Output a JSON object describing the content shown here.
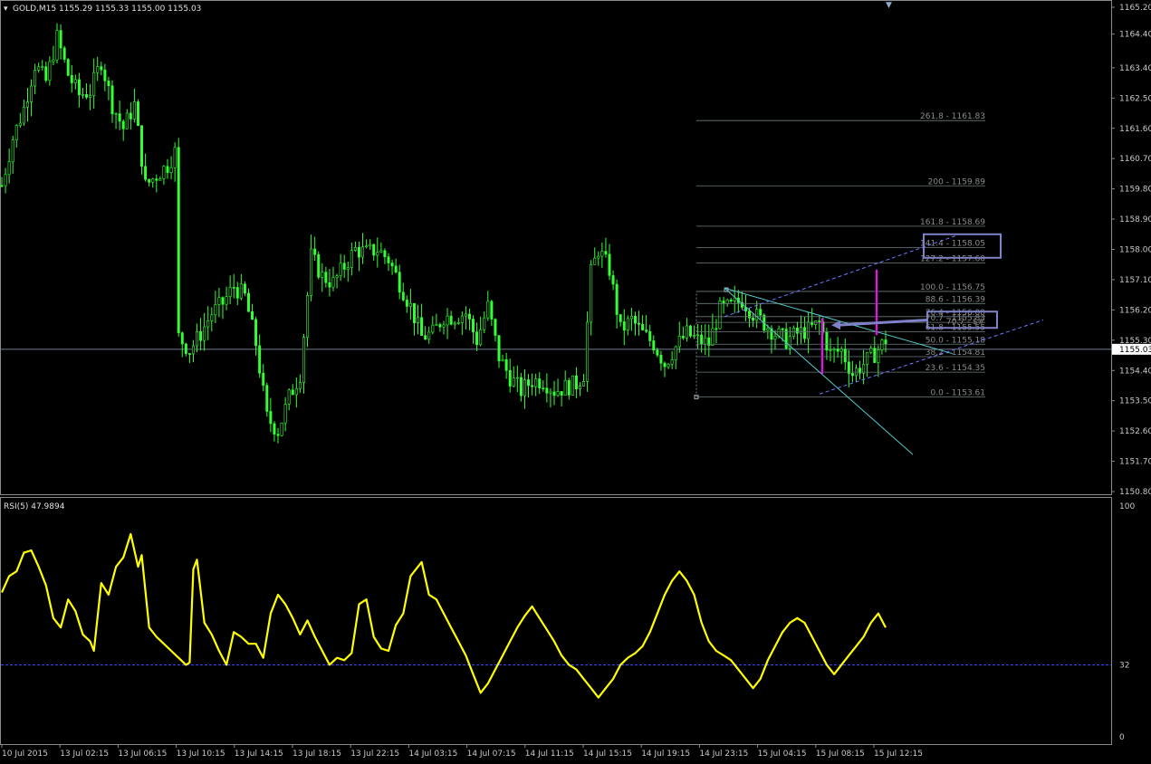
{
  "window": {
    "symbol_line": "GOLD,M15  1155.29 1155.33 1155.00 1155.03",
    "rsi_header": "RSI(5) 47.9894"
  },
  "colors": {
    "background": "#000000",
    "candle": "#34ff34",
    "rsi": "#ffff00",
    "trendline": "#52c8c8",
    "channel": "#6a7aff",
    "fib": "#6e7b7b",
    "box": "#7f82c8",
    "magenta": "#ff00ff",
    "price_line": "#8fa8c8",
    "level32": "#2a4cff"
  },
  "chart_data": [
    {
      "type": "candlestick",
      "title": "GOLD,M15",
      "ylim": [
        1150.8,
        1165.2
      ],
      "price_ticks": [
        "1165.20",
        "1164.40",
        "1163.40",
        "1162.50",
        "1161.60",
        "1160.70",
        "1159.80",
        "1158.90",
        "1158.00",
        "1157.10",
        "1156.20",
        "1155.30",
        "1154.40",
        "1153.50",
        "1152.60",
        "1151.70",
        "1150.80"
      ],
      "current_price": "1155.03",
      "x_labels": [
        "10 Jul 2015",
        "13 Jul 02:15",
        "13 Jul 06:15",
        "13 Jul 10:15",
        "13 Jul 14:15",
        "13 Jul 18:15",
        "13 Jul 22:15",
        "14 Jul 03:15",
        "14 Jul 07:15",
        "14 Jul 11:15",
        "14 Jul 15:15",
        "14 Jul 19:15",
        "14 Jul 23:15",
        "15 Jul 04:15",
        "15 Jul 08:15",
        "15 Jul 12:15"
      ],
      "close_path": [
        [
          0,
          1159.9
        ],
        [
          3,
          1161.3
        ],
        [
          6,
          1162.2
        ],
        [
          9,
          1163.5
        ],
        [
          12,
          1163.0
        ],
        [
          15,
          1164.3
        ],
        [
          18,
          1163.2
        ],
        [
          21,
          1162.6
        ],
        [
          24,
          1162.7
        ],
        [
          27,
          1163.6
        ],
        [
          30,
          1162.3
        ],
        [
          33,
          1161.6
        ],
        [
          36,
          1162.3
        ],
        [
          39,
          1159.9
        ],
        [
          42,
          1160.2
        ],
        [
          45,
          1160.5
        ],
        [
          47,
          1160.9
        ],
        [
          48,
          1155.4
        ],
        [
          51,
          1155.0
        ],
        [
          54,
          1155.5
        ],
        [
          57,
          1156.1
        ],
        [
          60,
          1156.4
        ],
        [
          63,
          1156.9
        ],
        [
          66,
          1156.6
        ],
        [
          69,
          1155.2
        ],
        [
          72,
          1153.0
        ],
        [
          75,
          1152.6
        ],
        [
          78,
          1153.6
        ],
        [
          81,
          1154.3
        ],
        [
          84,
          1157.8
        ],
        [
          87,
          1157.2
        ],
        [
          90,
          1157.0
        ],
        [
          93,
          1157.5
        ],
        [
          96,
          1158.0
        ],
        [
          99,
          1157.9
        ],
        [
          102,
          1158.0
        ],
        [
          105,
          1157.7
        ],
        [
          108,
          1157.0
        ],
        [
          111,
          1156.3
        ],
        [
          114,
          1155.4
        ],
        [
          117,
          1155.5
        ],
        [
          120,
          1156.0
        ],
        [
          123,
          1156.0
        ],
        [
          126,
          1156.1
        ],
        [
          129,
          1155.3
        ],
        [
          132,
          1156.3
        ],
        [
          135,
          1154.8
        ],
        [
          138,
          1154.2
        ],
        [
          141,
          1153.8
        ],
        [
          144,
          1154.1
        ],
        [
          147,
          1154.1
        ],
        [
          150,
          1153.8
        ],
        [
          153,
          1153.9
        ],
        [
          156,
          1154.0
        ],
        [
          158,
          1154.3
        ],
        [
          160,
          1157.3
        ],
        [
          162,
          1158.0
        ],
        [
          165,
          1157.4
        ],
        [
          168,
          1155.6
        ],
        [
          171,
          1155.9
        ],
        [
          174,
          1155.5
        ],
        [
          177,
          1155.2
        ],
        [
          180,
          1154.6
        ],
        [
          183,
          1155.1
        ],
        [
          186,
          1155.5
        ],
        [
          189,
          1155.3
        ],
        [
          192,
          1155.2
        ],
        [
          195,
          1156.2
        ],
        [
          198,
          1156.3
        ],
        [
          201,
          1156.5
        ],
        [
          204,
          1156.1
        ],
        [
          207,
          1155.8
        ],
        [
          210,
          1155.5
        ],
        [
          213,
          1155.3
        ],
        [
          216,
          1155.5
        ],
        [
          219,
          1155.6
        ],
        [
          222,
          1155.8
        ],
        [
          225,
          1154.9
        ],
        [
          228,
          1155.0
        ],
        [
          231,
          1154.3
        ],
        [
          234,
          1154.6
        ],
        [
          237,
          1154.9
        ],
        [
          240,
          1155.3
        ]
      ],
      "fib_levels": [
        {
          "ratio": "0.0",
          "price": 1153.61,
          "label": "0.0 - 1153.61"
        },
        {
          "ratio": "23.6",
          "price": 1154.35,
          "label": "23.6 - 1154.35"
        },
        {
          "ratio": "38.2",
          "price": 1154.81,
          "label": "38.2 - 1154.81"
        },
        {
          "ratio": "50.0",
          "price": 1155.18,
          "label": "50.0 - 1155.18"
        },
        {
          "ratio": "61.8",
          "price": 1155.55,
          "label": "61.8 - 1155.55"
        },
        {
          "ratio": "70.7",
          "price": 1155.83,
          "label": "70.7 - 1155.83"
        },
        {
          "ratio": "76.4",
          "price": 1156.0,
          "label": "76.4 - 1156.00"
        },
        {
          "ratio": "88.6",
          "price": 1156.39,
          "label": "88.6 - 1156.39"
        },
        {
          "ratio": "100.0",
          "price": 1156.75,
          "label": "100.0 - 1156.75"
        },
        {
          "ratio": "127.2",
          "price": 1157.6,
          "label": "127.2 - 1157.60"
        },
        {
          "ratio": "141.4",
          "price": 1158.05,
          "label": "141.4 - 1158.05"
        },
        {
          "ratio": "161.8",
          "price": 1158.69,
          "label": "161.8 - 1158.69"
        },
        {
          "ratio": "200",
          "price": 1159.89,
          "label": "200 - 1159.89"
        },
        {
          "ratio": "261.8",
          "price": 1161.83,
          "label": "261.8 - 1161.83"
        }
      ],
      "box_label": "70.7 - $#"
    },
    {
      "type": "line",
      "title": "RSI(5) 47.9894",
      "ylim": [
        0,
        100
      ],
      "ticks": [
        "100",
        "32",
        "0"
      ],
      "level": 32,
      "values": [
        [
          0,
          63
        ],
        [
          2,
          70
        ],
        [
          4,
          72
        ],
        [
          6,
          80
        ],
        [
          8,
          81
        ],
        [
          10,
          74
        ],
        [
          12,
          66
        ],
        [
          14,
          52
        ],
        [
          16,
          48
        ],
        [
          18,
          60
        ],
        [
          20,
          55
        ],
        [
          22,
          45
        ],
        [
          24,
          42
        ],
        [
          25,
          38
        ],
        [
          27,
          67
        ],
        [
          29,
          62
        ],
        [
          31,
          74
        ],
        [
          33,
          78
        ],
        [
          35,
          88
        ],
        [
          37,
          74
        ],
        [
          38,
          79
        ],
        [
          40,
          48
        ],
        [
          42,
          44
        ],
        [
          44,
          41
        ],
        [
          46,
          38
        ],
        [
          48,
          35
        ],
        [
          50,
          32
        ],
        [
          51,
          33
        ],
        [
          52,
          73
        ],
        [
          53,
          77
        ],
        [
          55,
          50
        ],
        [
          57,
          45
        ],
        [
          59,
          38
        ],
        [
          61,
          32
        ],
        [
          63,
          46
        ],
        [
          65,
          44
        ],
        [
          67,
          41
        ],
        [
          69,
          41
        ],
        [
          71,
          35
        ],
        [
          73,
          54
        ],
        [
          75,
          62
        ],
        [
          77,
          58
        ],
        [
          79,
          52
        ],
        [
          81,
          45
        ],
        [
          83,
          51
        ],
        [
          85,
          44
        ],
        [
          87,
          38
        ],
        [
          89,
          32
        ],
        [
          91,
          35
        ],
        [
          93,
          34
        ],
        [
          95,
          37
        ],
        [
          97,
          58
        ],
        [
          99,
          60
        ],
        [
          101,
          44
        ],
        [
          103,
          39
        ],
        [
          105,
          38
        ],
        [
          107,
          49
        ],
        [
          109,
          54
        ],
        [
          111,
          70
        ],
        [
          113,
          74
        ],
        [
          114,
          76
        ],
        [
          116,
          62
        ],
        [
          118,
          60
        ],
        [
          120,
          54
        ],
        [
          122,
          48
        ],
        [
          124,
          42
        ],
        [
          126,
          36
        ],
        [
          128,
          28
        ],
        [
          130,
          20
        ],
        [
          132,
          24
        ],
        [
          134,
          30
        ],
        [
          136,
          36
        ],
        [
          138,
          42
        ],
        [
          140,
          48
        ],
        [
          142,
          53
        ],
        [
          144,
          57
        ],
        [
          146,
          52
        ],
        [
          148,
          47
        ],
        [
          150,
          42
        ],
        [
          152,
          36
        ],
        [
          154,
          32
        ],
        [
          156,
          30
        ],
        [
          158,
          26
        ],
        [
          160,
          22
        ],
        [
          162,
          18
        ],
        [
          164,
          22
        ],
        [
          166,
          26
        ],
        [
          168,
          32
        ],
        [
          170,
          35
        ],
        [
          172,
          37
        ],
        [
          174,
          40
        ],
        [
          176,
          46
        ],
        [
          178,
          54
        ],
        [
          180,
          62
        ],
        [
          182,
          68
        ],
        [
          184,
          72
        ],
        [
          186,
          68
        ],
        [
          188,
          62
        ],
        [
          190,
          50
        ],
        [
          192,
          42
        ],
        [
          194,
          38
        ],
        [
          196,
          36
        ],
        [
          198,
          34
        ],
        [
          200,
          30
        ],
        [
          202,
          26
        ],
        [
          204,
          22
        ],
        [
          206,
          26
        ],
        [
          208,
          34
        ],
        [
          210,
          40
        ],
        [
          212,
          46
        ],
        [
          214,
          50
        ],
        [
          216,
          52
        ],
        [
          218,
          50
        ],
        [
          220,
          44
        ],
        [
          222,
          38
        ],
        [
          224,
          32
        ],
        [
          226,
          28
        ],
        [
          228,
          32
        ],
        [
          230,
          36
        ],
        [
          232,
          40
        ],
        [
          234,
          44
        ],
        [
          236,
          50
        ],
        [
          238,
          54
        ],
        [
          240,
          48
        ]
      ]
    }
  ]
}
